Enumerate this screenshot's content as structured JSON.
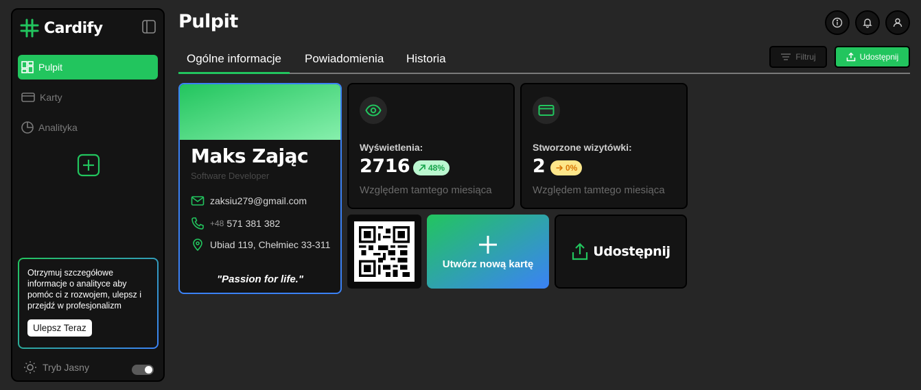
{
  "app": {
    "name": "Cardify"
  },
  "colors": {
    "accent": "#22c55e",
    "secondary": "#3b82f6",
    "background": "#262626",
    "surface": "#141414"
  },
  "sidebar": {
    "items": [
      {
        "label": "Pulpit",
        "icon": "dashboard-icon",
        "active": true
      },
      {
        "label": "Karty",
        "icon": "card-icon",
        "active": false
      },
      {
        "label": "Analityka",
        "icon": "pie-chart-icon",
        "active": false
      }
    ],
    "add_icon": "plus-square-icon",
    "promo": {
      "text": "Otrzymuj szczegółowe informacje o analityce aby pomóc ci z rozwojem, ulepsz i przejdź w profesjonalizm",
      "button": "Ulepsz Teraz"
    },
    "theme_toggle": {
      "label": "Tryb Jasny",
      "on": true
    }
  },
  "header": {
    "title": "Pulpit",
    "tabs": [
      "Ogólne informacje",
      "Powiadomienia",
      "Historia"
    ],
    "active_tab": 0,
    "filter_label": "Filtruj",
    "share_label": "Udostępnij",
    "icons": [
      "info-icon",
      "bell-icon",
      "user-icon"
    ]
  },
  "profile_card": {
    "name": "Maks Zając",
    "role": "Software Developer",
    "email": "zaksiu279@gmail.com",
    "phone_prefix": "+48",
    "phone": "571 381 382",
    "address": "Ubiad 119, Chełmiec 33-311",
    "quote": "\"Passion for life.\""
  },
  "stats": [
    {
      "label": "Wyświetlenia:",
      "value": "2716",
      "change": "48%",
      "trend": "up",
      "sub": "Względem tamtego miesiąca",
      "icon": "eye-icon"
    },
    {
      "label": "Stworzone wizytówki:",
      "value": "2",
      "change": "0%",
      "trend": "neutral",
      "sub": "Względem tamtego miesiąca",
      "icon": "card-icon"
    }
  ],
  "tiles": {
    "create_label": "Utwórz nową kartę",
    "share_label": "Udostępnij"
  }
}
